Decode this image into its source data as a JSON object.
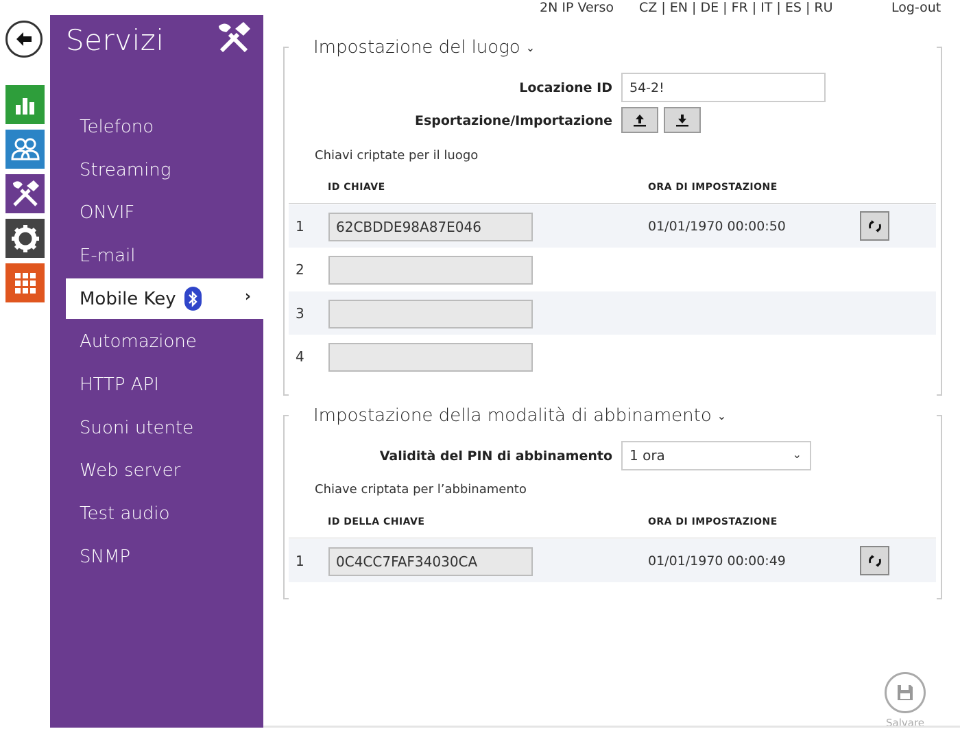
{
  "topbar": {
    "device": "2N IP Verso",
    "languages": "CZ | EN | DE | FR | IT | ES | RU",
    "logout": "Log-out"
  },
  "rail": {
    "tiles": [
      {
        "icon": "status-chart-icon",
        "color": "#2e9e3b"
      },
      {
        "icon": "directory-users-icon",
        "color": "#2b84c6"
      },
      {
        "icon": "services-tools-icon",
        "color": "#6a3b8f"
      },
      {
        "icon": "hardware-gear-icon",
        "color": "#444444"
      },
      {
        "icon": "system-grid-icon",
        "color": "#e0561f"
      }
    ]
  },
  "sidebar": {
    "title": "Servizi",
    "items": [
      "Telefono",
      "Streaming",
      "ONVIF",
      "E-mail",
      "Mobile Key",
      "Automazione",
      "HTTP API",
      "Suoni utente",
      "Web server",
      "Test audio",
      "SNMP"
    ],
    "active": "Mobile Key"
  },
  "location": {
    "title": "Impostazione del luogo",
    "location_id_label": "Locazione ID",
    "location_id_value": "54-2!",
    "export_import_label": "Esportazione/Importazione",
    "keys_label": "Chiavi criptate per il luogo",
    "col_key_id": "ID CHIAVE",
    "col_time": "ORA DI IMPOSTAZIONE",
    "rows": [
      {
        "num": "1",
        "key": "62CBDDE98A87E046",
        "time": "01/01/1970 00:00:50"
      },
      {
        "num": "2",
        "key": "",
        "time": ""
      },
      {
        "num": "3",
        "key": "",
        "time": ""
      },
      {
        "num": "4",
        "key": "",
        "time": ""
      }
    ]
  },
  "pairing": {
    "title": "Impostazione della modalità di abbinamento",
    "pin_validity_label": "Validità del PIN di abbinamento",
    "pin_validity_value": "1 ora",
    "key_label": "Chiave criptata per l’abbinamento",
    "col_key_id": "ID DELLA CHIAVE",
    "col_time": "ORA DI IMPOSTAZIONE",
    "rows": [
      {
        "num": "1",
        "key": "0C4CC7FAF34030CA",
        "time": "01/01/1970 00:00:49"
      }
    ]
  },
  "save": {
    "label": "Salvare"
  },
  "colors": {
    "sidebar": "#6a3b8f",
    "bluetooth": "#2f45c9"
  }
}
